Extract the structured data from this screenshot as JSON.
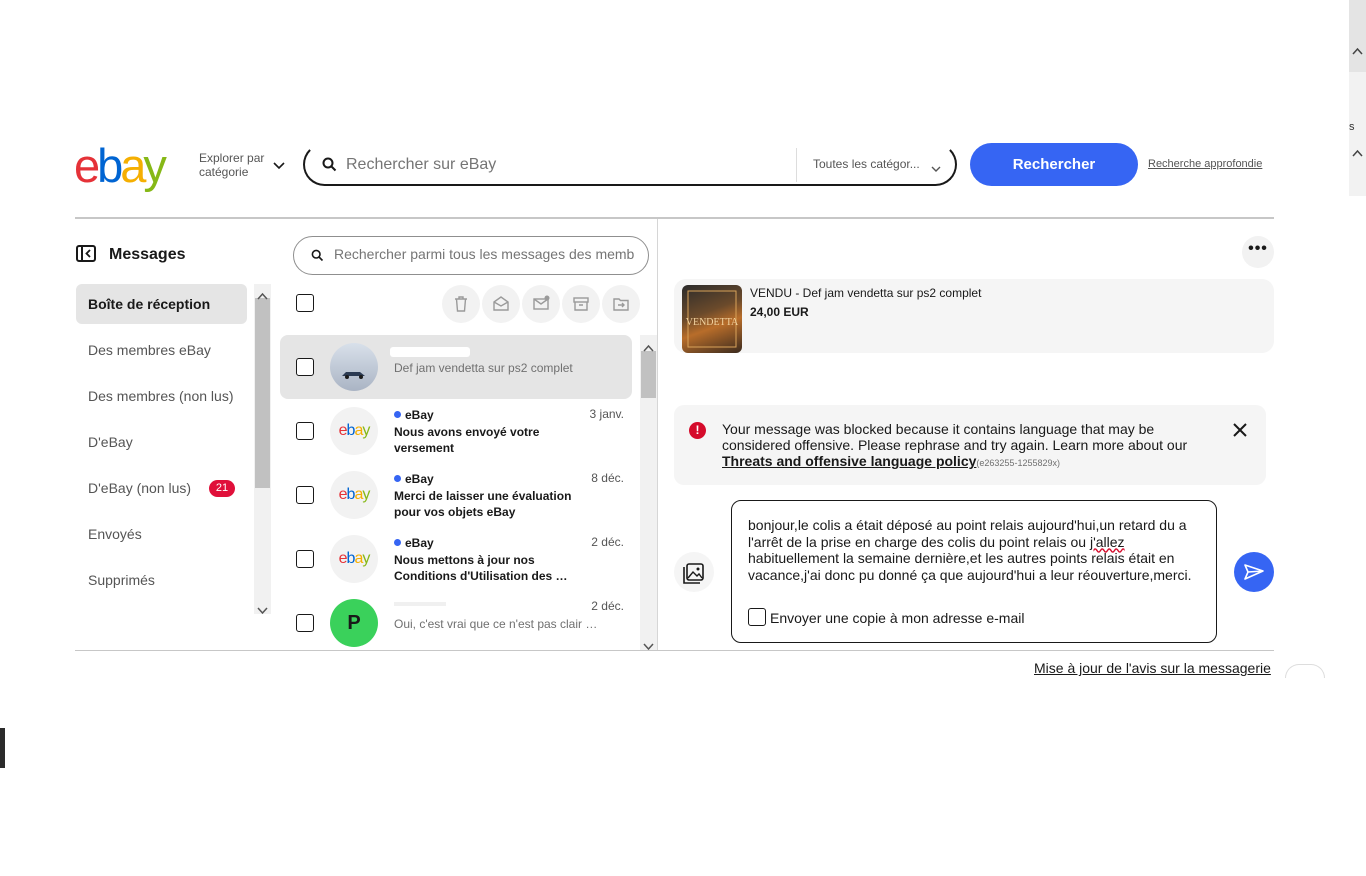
{
  "header": {
    "explore_line1": "Explorer par",
    "explore_line2": "catégorie",
    "search_placeholder": "Rechercher sur eBay",
    "category_select": "Toutes les catégor...",
    "search_button": "Rechercher",
    "advanced_link": "Recherche approfondie"
  },
  "browser": {
    "strip_letter": "s"
  },
  "nav": {
    "title": "Messages",
    "items": [
      {
        "label": "Boîte de réception",
        "active": true
      },
      {
        "label": "Des membres eBay"
      },
      {
        "label": "Des membres (non lus)"
      },
      {
        "label": "D'eBay"
      },
      {
        "label": "D'eBay (non lus)",
        "badge": "21"
      },
      {
        "label": "Envoyés"
      },
      {
        "label": "Supprimés"
      }
    ]
  },
  "list": {
    "search_placeholder": "Rechercher parmi tous les messages des membres",
    "tools": [
      "delete-icon",
      "mark-read-icon",
      "mark-unread-icon",
      "archive-icon",
      "move-folder-icon"
    ],
    "messages": [
      {
        "sender": "",
        "subject": "",
        "preview": "Def jam vendetta sur ps2 complet",
        "date": "",
        "selected": true
      },
      {
        "sender": "eBay",
        "subject": "Nous avons envoyé votre versement",
        "date": "3 janv."
      },
      {
        "sender": "eBay",
        "subject": "Merci de laisser une évaluation pour vos objets eBay",
        "date": "8 déc."
      },
      {
        "sender": "eBay",
        "subject": "Nous mettons à jour nos Conditions d'Utilisation des …",
        "date": "2 déc."
      },
      {
        "sender": "",
        "avatar_letter": "P",
        "preview": "Oui, c'est vrai que ce n'est pas clair …",
        "date": "2 déc."
      }
    ]
  },
  "conversation": {
    "item_title": "VENDU - Def jam vendetta sur ps2 complet",
    "item_price": "24,00 EUR",
    "alert_text": "Your message was blocked because it contains language that may be considered offensive. Please rephrase and try again. Learn more about our",
    "alert_link": "Threats and offensive language policy",
    "alert_code": "(e263255-1255829x)",
    "compose_before": "bonjour,le colis a était déposé au point relais aujourd'hui,un retard du a l'arrêt de la prise en charge des colis du point relais ou ",
    "compose_flagged": "j'allez",
    "compose_after": " habituellement la semaine dernière,et les autres points relais était en vacance,j'ai donc pu donné ça que aujourd'hui a leur réouverture,merci.",
    "copy_label": "Envoyer une copie à mon adresse e-mail"
  },
  "footer": {
    "notice_link": "Mise à jour de l'avis sur la messagerie"
  },
  "colors": {
    "ebay_red": "#e53238",
    "ebay_blue": "#0064d2",
    "ebay_yellow": "#f5af02",
    "ebay_green": "#86b817",
    "accent": "#3665f3",
    "alert_red": "#d50b2b",
    "avatar_green": "#3ad15b"
  }
}
